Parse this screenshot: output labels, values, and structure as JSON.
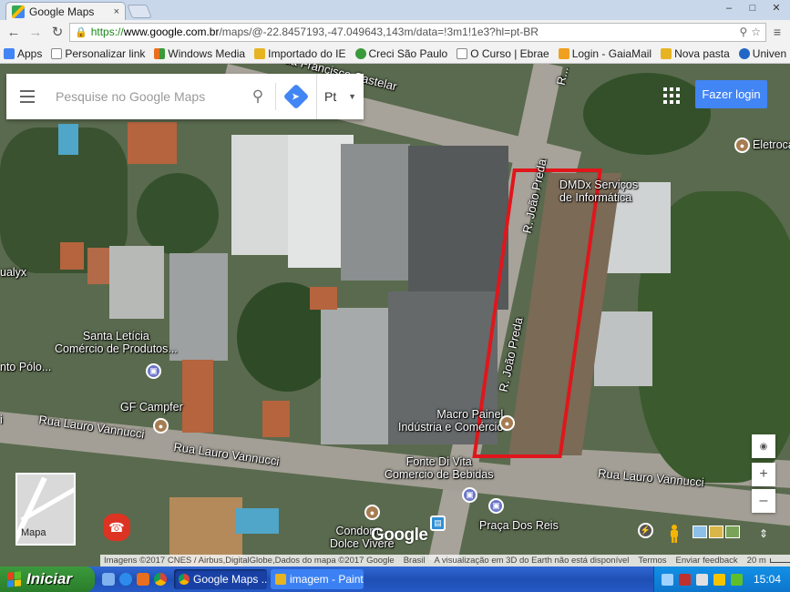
{
  "browser": {
    "tab_title": "Google Maps",
    "tab_close": "×",
    "window_controls": [
      "–",
      "□",
      "✕"
    ],
    "url_scheme": "https://",
    "url_host": "www.google.com.br",
    "url_path": "/maps/@-22.8457193,-47.049643,143m/data=!3m1!1e3?hl=pt-BR"
  },
  "bookmarks": [
    {
      "label": "Apps",
      "color": "#4285f4"
    },
    {
      "label": "Personalizar link",
      "color": "#888888"
    },
    {
      "label": "Windows Media",
      "color": "#e86f1f"
    },
    {
      "label": "Importado do IE",
      "color": "#e6b422"
    },
    {
      "label": "Creci São Paulo",
      "color": "#3a9a3a"
    },
    {
      "label": "O Curso | Ebrae",
      "color": "#cccccc"
    },
    {
      "label": "Login - GaiaMail",
      "color": "#f0a020"
    },
    {
      "label": "Nova pasta",
      "color": "#e6b422"
    },
    {
      "label": "Univen - Sua im",
      "color": "#2166c4"
    }
  ],
  "search": {
    "placeholder": "Pesquise no Google Maps",
    "language": "Pt"
  },
  "signin_label": "Fazer login",
  "map_labels": {
    "street_top": "...ua Francisco Castelar",
    "street_top_right": "R...",
    "joao_preda_upper": "R. João Preda",
    "joao_preda_lower": "R. João Preda",
    "lauro_left": "Rua Lauro Vannucci",
    "lauro_mid": "Rua Lauro Vannucci",
    "lauro_right": "Rua Lauro Vannucci",
    "dmdx": "DMDx Serviços\nde Informática",
    "eletroca": "Eletroca",
    "santa_leticia": "Santa Letícia\nComércio de Produtos...",
    "nto_polo": "nto Pólo...",
    "ualyx": "ualyx",
    "gf_campfer": "GF Campfer",
    "macro_painel": "Macro Painel\nIndústria e Comércio",
    "fonte_di_vita": "Fonte Di Vita\nComercio de Bebidas",
    "condominio": "Condom...\nDolce Vivere",
    "praca_dos_reis": "Praça Dos Reis",
    "left_edge_i": "i"
  },
  "minimap_label": "Mapa",
  "google_logo": "Google",
  "attribution": {
    "imagery": "Imagens ©2017 CNES / Airbus,DigitalGlobe,Dados do mapa ©2017 Google",
    "country": "Brasil",
    "earth_notice": "A visualização em 3D do Earth não está disponível",
    "terms": "Termos",
    "feedback": "Enviar feedback",
    "scale": "20 m"
  },
  "zoom": {
    "plus": "+",
    "minus": "–"
  },
  "taskbar": {
    "start": "Iniciar",
    "items": [
      {
        "label": "Google Maps ...",
        "active": true,
        "color": "#4285f4"
      },
      {
        "label": "imagem - Paint",
        "active": false,
        "color": "#e6b422"
      }
    ],
    "clock": "15:04"
  }
}
